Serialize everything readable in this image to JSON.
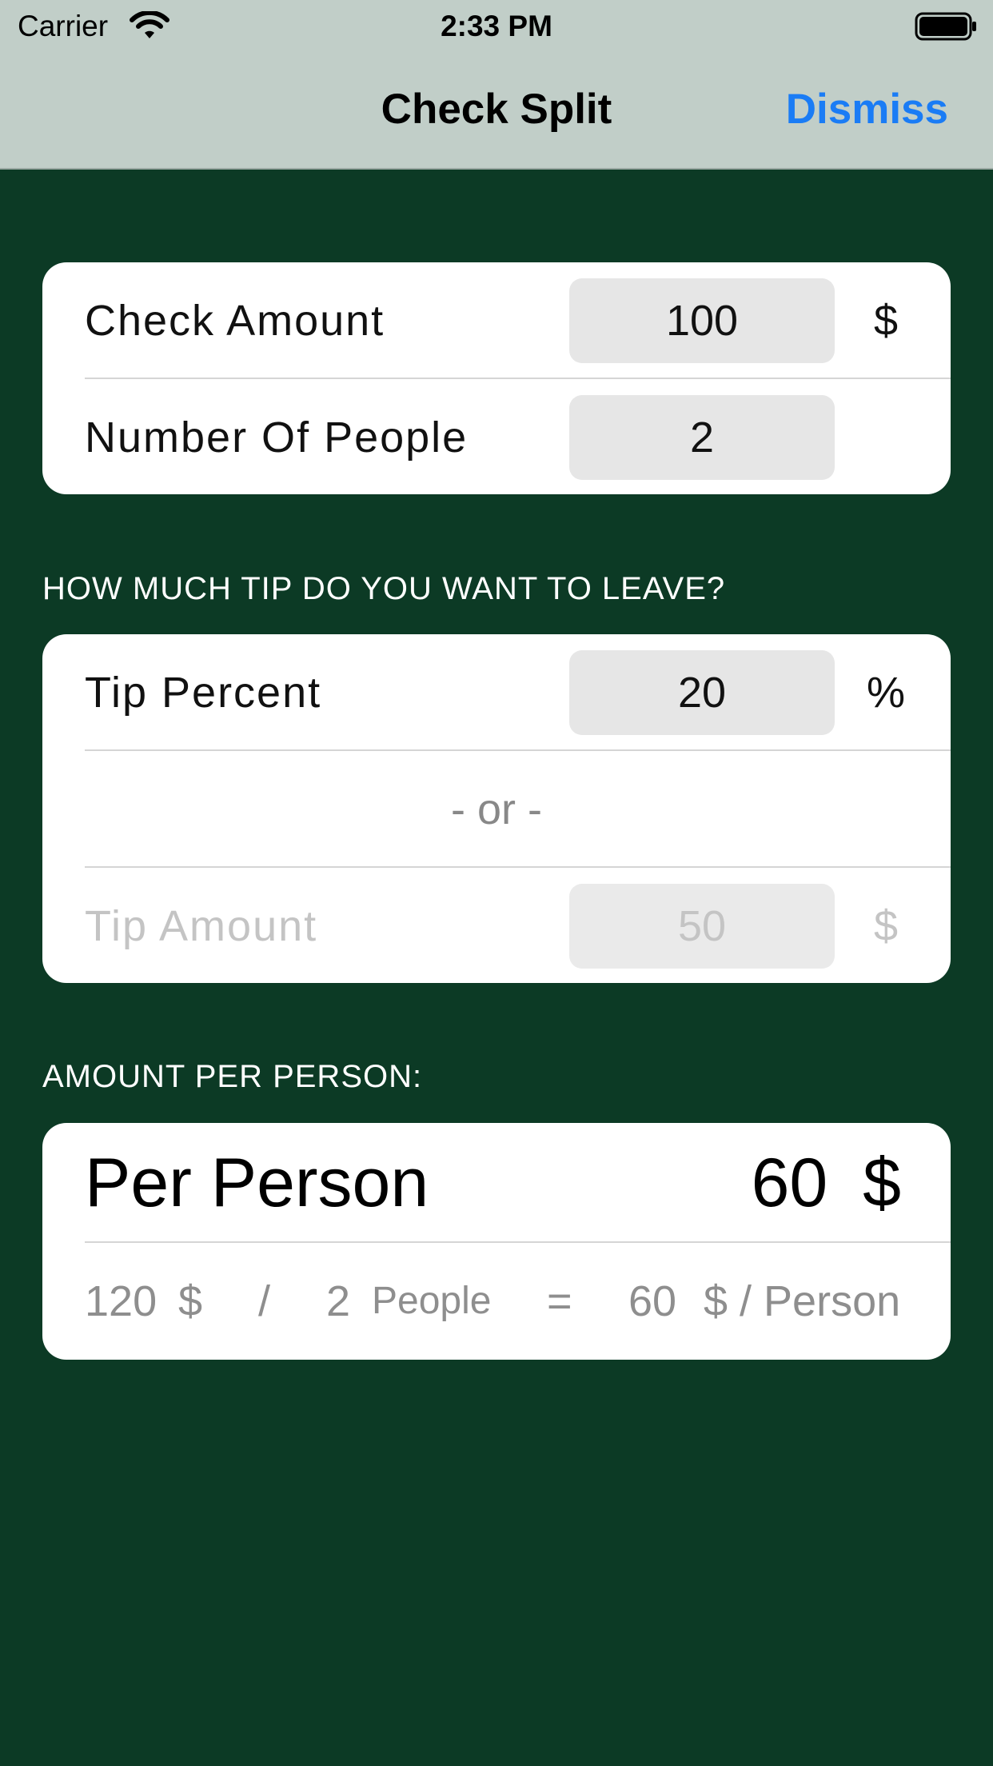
{
  "status_bar": {
    "carrier": "Carrier",
    "time": "2:33 PM",
    "wifi_icon": "wifi-icon",
    "battery_icon": "battery-full-icon"
  },
  "nav": {
    "title": "Check Split",
    "dismiss_label": "Dismiss",
    "tint_color": "#1a7cf5"
  },
  "colors": {
    "background": "#0c3a25",
    "nav_background": "#c1cec8",
    "card": "#ffffff",
    "field": "#e6e6e6"
  },
  "check": {
    "check_amount_label": "Check Amount",
    "check_amount_value": "100",
    "check_amount_unit": "$",
    "people_label": "Number Of People",
    "people_value": "2"
  },
  "tip_section": {
    "header": "HOW MUCH TIP DO YOU WANT TO LEAVE?",
    "tip_percent_label": "Tip Percent",
    "tip_percent_value": "20",
    "tip_percent_unit": "%",
    "or_label": "- or -",
    "tip_amount_label": "Tip Amount",
    "tip_amount_value": "50",
    "tip_amount_unit": "$"
  },
  "per_person_section": {
    "header": "AMOUNT PER PERSON:",
    "label": "Per Person",
    "value": "60",
    "unit": "$",
    "formula": {
      "total": "120",
      "total_unit": "$",
      "divide": "/",
      "people": "2",
      "people_label": "People",
      "equals": "=",
      "result": "60",
      "result_unit": "$ / Person"
    }
  }
}
